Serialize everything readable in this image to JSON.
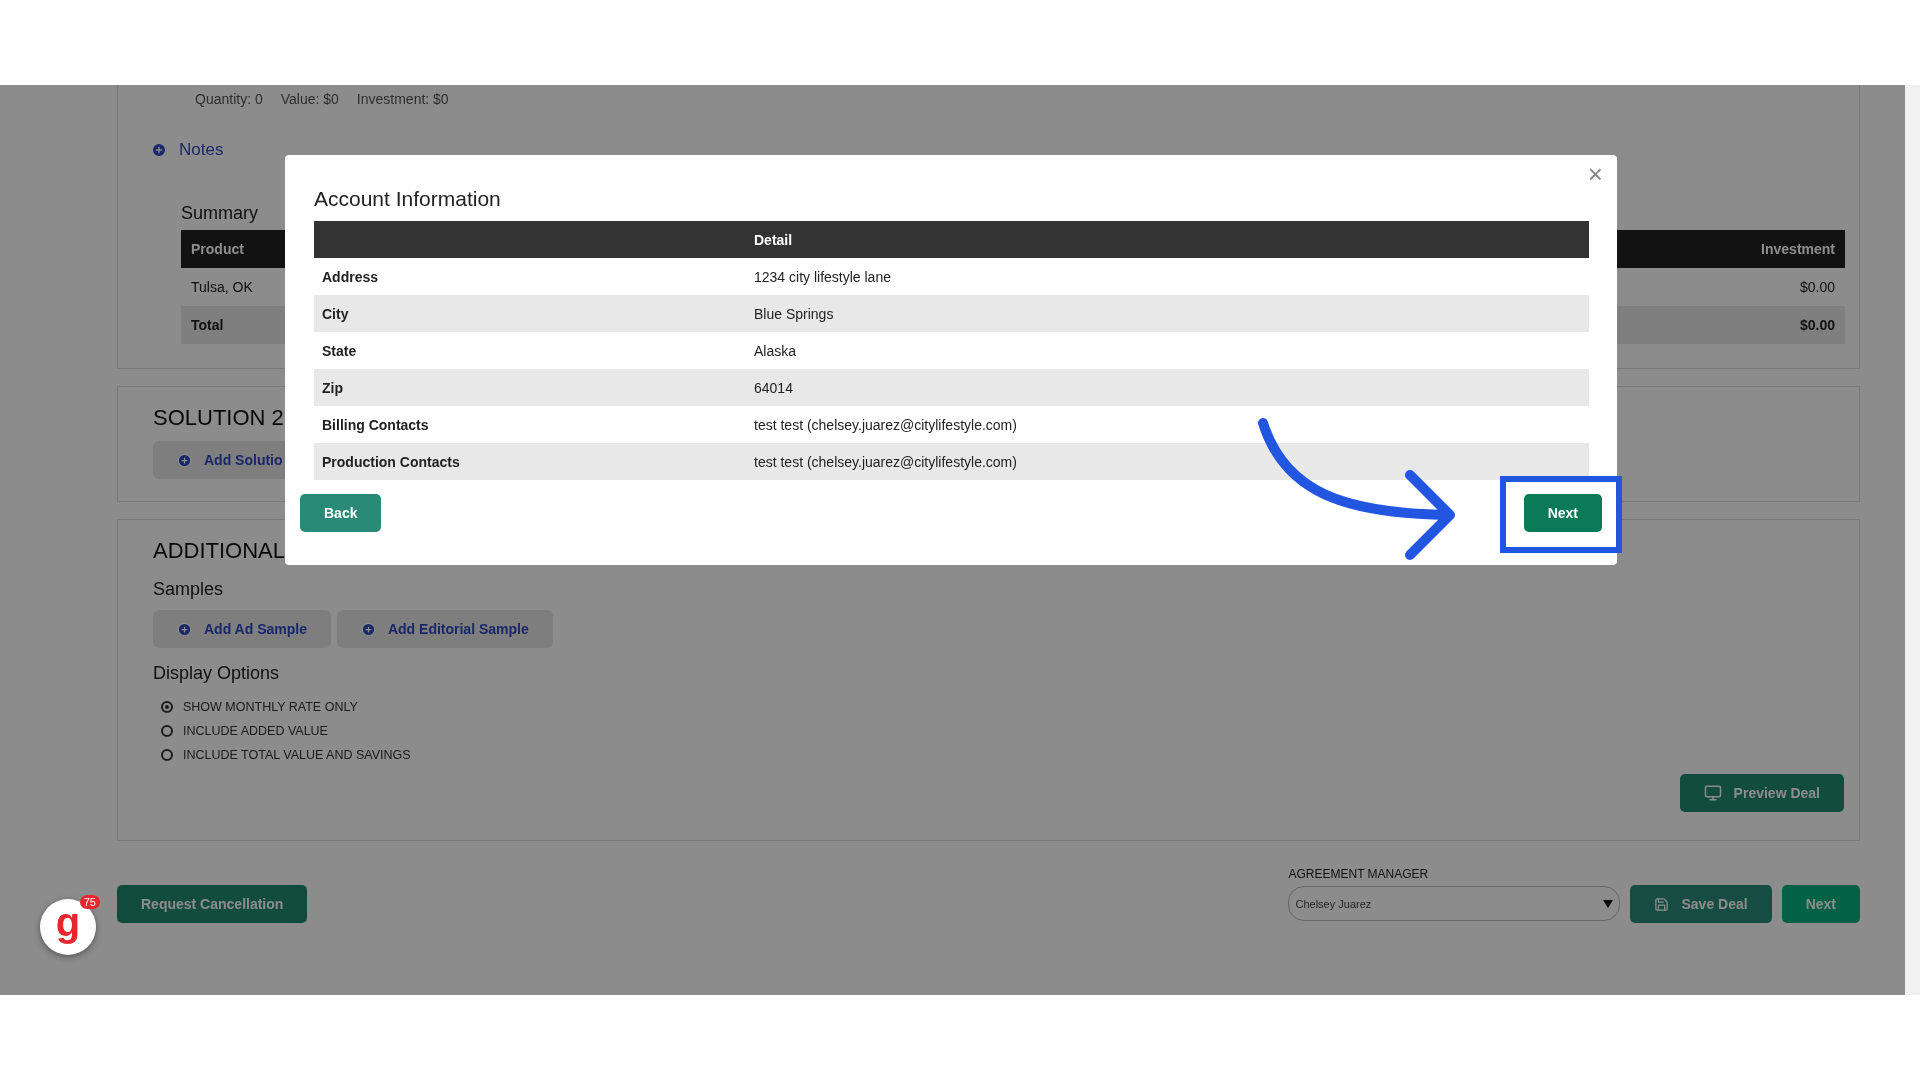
{
  "stats": [
    "Quantity: 0",
    "Value: $0",
    "Investment: $0"
  ],
  "notes_link": "Notes",
  "summary": {
    "title": "Summary",
    "columns": [
      "Product",
      "Investment"
    ],
    "rows": [
      {
        "kind": "item",
        "cells": [
          "Tulsa, OK",
          "$0.00"
        ]
      },
      {
        "kind": "total",
        "cells": [
          "Total",
          "$0.00"
        ]
      }
    ]
  },
  "solution": {
    "title": "SOLUTION 2",
    "button": "Add Solutio"
  },
  "additional": {
    "title": "ADDITIONAL",
    "samples_title": "Samples",
    "sample_buttons": [
      "Add Ad Sample",
      "Add Editorial Sample"
    ],
    "display_title": "Display Options",
    "options": [
      {
        "label": "SHOW MONTHLY RATE ONLY",
        "selected": true
      },
      {
        "label": "INCLUDE ADDED VALUE",
        "selected": false
      },
      {
        "label": "INCLUDE TOTAL VALUE AND SAVINGS",
        "selected": false
      }
    ],
    "preview_button": "Preview Deal"
  },
  "footer": {
    "cancel_button": "Request Cancellation",
    "manager_label": "AGREEMENT MANAGER",
    "manager_value": "Chelsey Juarez",
    "save_button": "Save Deal",
    "next_button": "Next"
  },
  "badge": {
    "logo": "g",
    "count": "75"
  },
  "modal": {
    "title": "Account Information",
    "close": "×",
    "header": {
      "detail": "Detail"
    },
    "rows": [
      [
        "Address",
        "1234 city lifestyle lane"
      ],
      [
        "City",
        "Blue Springs"
      ],
      [
        "State",
        "Alaska"
      ],
      [
        "Zip",
        "64014"
      ],
      [
        "Billing Contacts",
        "test test (chelsey.juarez@citylifestyle.com)"
      ],
      [
        "Production Contacts",
        "test test (chelsey.juarez@citylifestyle.com)"
      ]
    ],
    "back_button": "Back",
    "next_button": "Next"
  }
}
